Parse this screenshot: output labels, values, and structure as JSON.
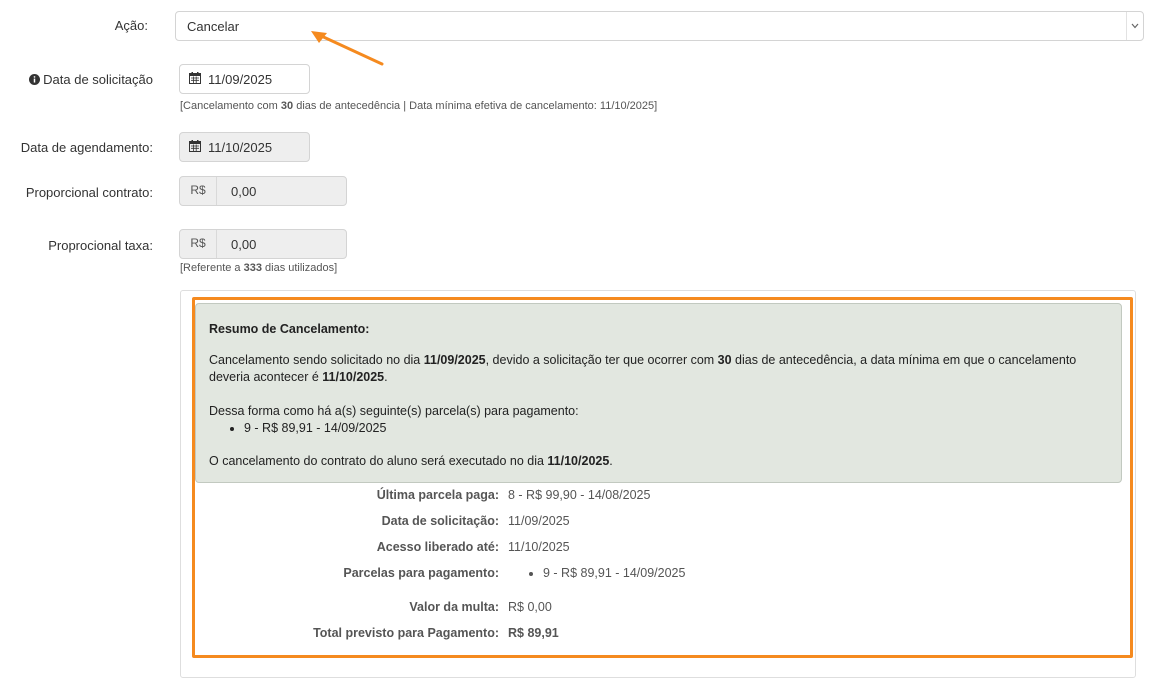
{
  "acao": {
    "label": "Ação:",
    "value": "Cancelar"
  },
  "data_solicitacao": {
    "label": "Data de solicitação",
    "value": "11/09/2025",
    "help_prefix": "[Cancelamento com ",
    "help_days": "30",
    "help_suffix": " dias de antecedência | Data mínima efetiva de cancelamento: 11/10/2025]"
  },
  "data_agendamento": {
    "label": "Data de agendamento:",
    "value": "11/10/2025"
  },
  "proporcional_contrato": {
    "label": "Proporcional contrato:",
    "currency": "R$",
    "value": "0,00"
  },
  "proporcional_taxa": {
    "label": "Proprocional taxa:",
    "currency": "R$",
    "value": "0,00",
    "help_prefix": "[Referente a ",
    "help_days": "333",
    "help_suffix": " dias utilizados]"
  },
  "resumo": {
    "title": "Resumo de Cancelamento:",
    "p1_a": "Cancelamento sendo solicitado no dia ",
    "p1_date": "11/09/2025",
    "p1_b": ", devido a solicitação ter que ocorrer com ",
    "p1_days": "30",
    "p1_c": " dias de antecedência, a data mínima em que o cancelamento deveria acontecer é ",
    "p1_min": "11/10/2025",
    "p1_d": ".",
    "p2": "Dessa forma como há a(s) seguinte(s) parcela(s) para pagamento:",
    "parcelas": [
      "9 - R$ 89,91 - 14/09/2025"
    ],
    "p3_a": "O cancelamento do contrato do aluno será executado no dia ",
    "p3_date": "11/10/2025",
    "p3_b": "."
  },
  "detalhes": {
    "ultima_parcela_label": "Última parcela paga:",
    "ultima_parcela_value": "8 - R$ 99,90 - 14/08/2025",
    "data_solicitacao_label": "Data de solicitação:",
    "data_solicitacao_value": "11/09/2025",
    "acesso_label": "Acesso liberado até:",
    "acesso_value": "11/10/2025",
    "parcelas_label": "Parcelas para pagamento:",
    "parcelas_value": "9 - R$ 89,91 - 14/09/2025",
    "multa_label": "Valor da multa:",
    "multa_value": "R$ 0,00",
    "total_label": "Total previsto para Pagamento:",
    "total_value": "R$ 89,91"
  },
  "colors": {
    "highlight": "#f58a1f",
    "alert_bg": "#e2e7e0"
  },
  "icons": {
    "info": "info-circle-icon",
    "calendar": "calendar-icon",
    "chevron": "chevron-down-icon",
    "arrow": "orange-arrow-annotation"
  }
}
